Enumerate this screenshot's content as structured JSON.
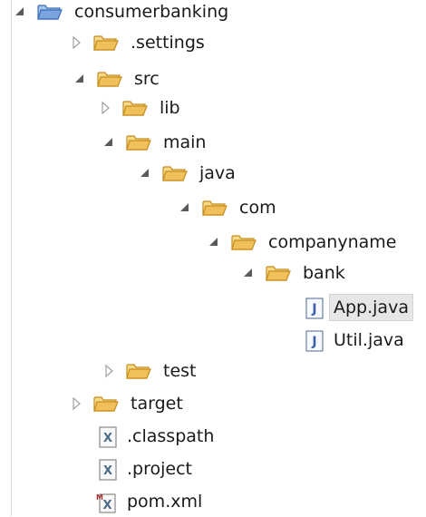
{
  "tree": {
    "project": {
      "label": "consumerbanking",
      "icon": "project-folder-icon",
      "expanded": true
    },
    "items": [
      {
        "label": ".settings",
        "icon": "folder-icon",
        "expanded": false
      },
      {
        "label": "src",
        "icon": "folder-icon",
        "expanded": true
      },
      {
        "label": "lib",
        "icon": "folder-icon",
        "expanded": false
      },
      {
        "label": "main",
        "icon": "folder-icon",
        "expanded": true
      },
      {
        "label": "java",
        "icon": "folder-icon",
        "expanded": true
      },
      {
        "label": "com",
        "icon": "folder-icon",
        "expanded": true
      },
      {
        "label": "companyname",
        "icon": "folder-icon",
        "expanded": true
      },
      {
        "label": "bank",
        "icon": "folder-icon",
        "expanded": true
      },
      {
        "label": "App.java",
        "icon": "java-file-icon",
        "selected": true
      },
      {
        "label": "Util.java",
        "icon": "java-file-icon"
      },
      {
        "label": "test",
        "icon": "folder-icon",
        "expanded": false
      },
      {
        "label": "target",
        "icon": "folder-icon",
        "expanded": false
      },
      {
        "label": ".classpath",
        "icon": "xml-file-icon"
      },
      {
        "label": ".project",
        "icon": "xml-file-icon"
      },
      {
        "label": "pom.xml",
        "icon": "maven-pom-icon"
      }
    ]
  },
  "colors": {
    "folder": "#f0c15a",
    "folder_border": "#c68c1a",
    "twisty": "#5a5a5a",
    "selection": "#e6e6e6"
  }
}
